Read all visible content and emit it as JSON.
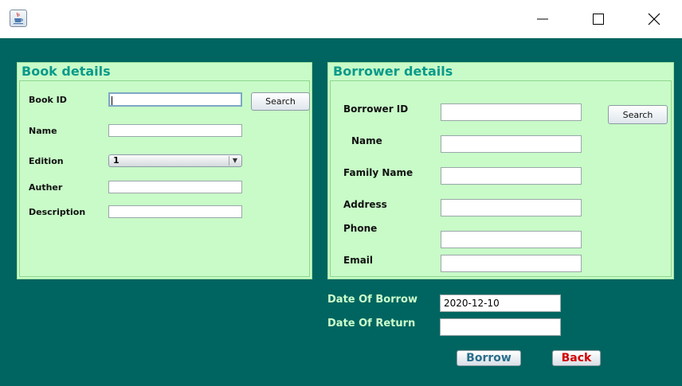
{
  "window": {
    "icon": "java-cup-icon",
    "controls": {
      "minimize": "minimize-icon",
      "maximize": "maximize-icon",
      "close": "close-icon"
    }
  },
  "book_panel": {
    "title": "Book details",
    "book_id_label": "Book ID",
    "book_id_value": "",
    "search_label": "Search",
    "name_label": "Name",
    "name_value": "",
    "edition_label": "Edition",
    "edition_selected": "1",
    "auther_label": "Auther",
    "auther_value": "",
    "description_label": "Description",
    "description_value": ""
  },
  "borrower_panel": {
    "title": "Borrower details",
    "borrower_id_label": "Borrower  ID",
    "borrower_id_value": "",
    "search_label": "Search",
    "name_label": "Name",
    "name_value": "",
    "family_name_label": "Family Name",
    "family_name_value": "",
    "address_label": "Address",
    "address_value": "",
    "phone_label": "Phone",
    "phone_value": "",
    "email_label": "Email",
    "email_value": ""
  },
  "dates": {
    "borrow_label": "Date Of Borrow",
    "borrow_value": "2020-12-10",
    "return_label": "Date Of Return",
    "return_value": ""
  },
  "actions": {
    "borrow_label": "Borrow",
    "back_label": "Back"
  },
  "colors": {
    "background": "#006560",
    "panel": "#c8fbc8",
    "panel_title": "#0a9a8a",
    "date_label": "#ccffcc",
    "borrow_text": "#2a6e8c",
    "back_text": "#d40000"
  }
}
